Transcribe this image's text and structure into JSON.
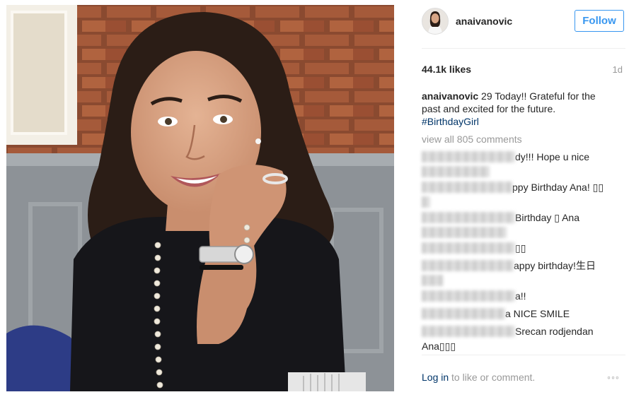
{
  "post": {
    "username": "anaivanovic",
    "follow_label": "Follow",
    "likes": "44.1k likes",
    "age": "1d",
    "caption": {
      "username": "anaivanovic",
      "text": "29 Today!! Grateful for the past and excited for the future.",
      "hashtag": "#BirthdayGirl"
    },
    "view_all_comments": "view all 805 comments",
    "comments": [
      {
        "text": "dy!!! Hope u nice"
      },
      {
        "text": "ppy Birthday Ana! ▯▯"
      },
      {
        "text": "Birthday ▯ Ana"
      },
      {
        "text": "▯▯"
      },
      {
        "text": "appy birthday!生日"
      },
      {
        "text": "a!!"
      },
      {
        "text": "a NICE SMILE"
      },
      {
        "text": "Srecan rodjendan"
      },
      {
        "text": "Ana▯▯▯"
      }
    ],
    "footer": {
      "login_link": "Log in",
      "login_text": " to like or comment.",
      "more_label": "◦◦◦"
    }
  },
  "icons": {
    "more": "more-options-icon"
  },
  "colors": {
    "follow_blue": "#3897f0",
    "hashtag": "#003569",
    "muted": "#999999"
  }
}
